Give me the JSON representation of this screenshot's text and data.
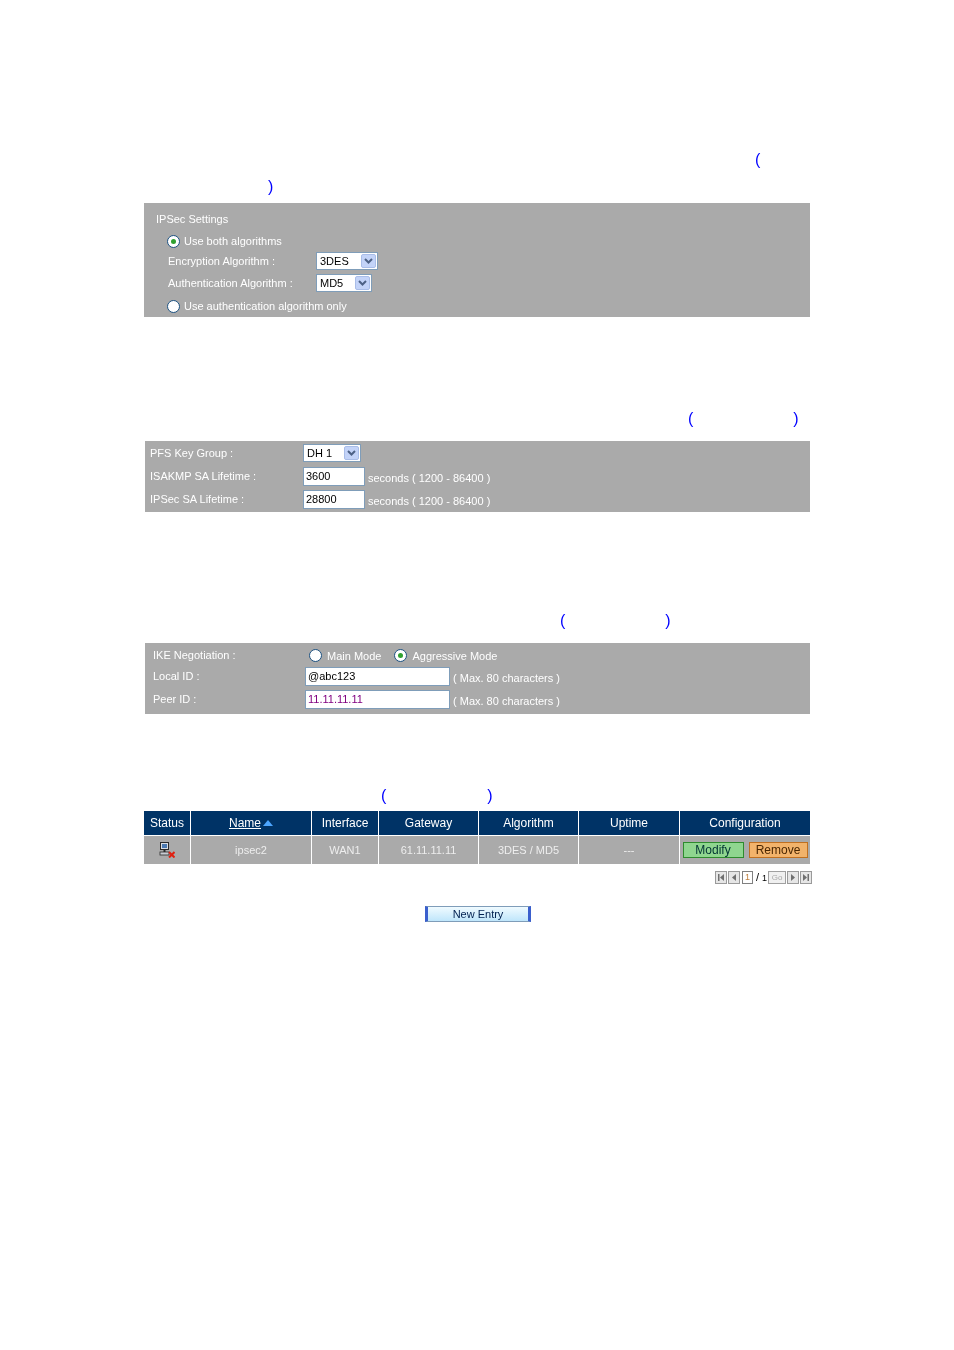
{
  "ipsec_settings": {
    "brackets": [
      "(",
      ")"
    ],
    "title": "IPSec Settings",
    "options": [
      {
        "label": "Use both algorithms",
        "selected": true,
        "fields": [
          {
            "label": "Encryption Algorithm :",
            "value": "3DES"
          },
          {
            "label": "Authentication Algorithm :",
            "value": "MD5"
          }
        ]
      },
      {
        "label": "Use authentication algorithm only",
        "selected": false
      }
    ]
  },
  "lifetime_settings": {
    "brackets": [
      "(",
      ")"
    ],
    "rows": [
      {
        "kind": "select",
        "label": "PFS Key Group :",
        "value": "DH 1"
      },
      {
        "kind": "input",
        "label": "ISAKMP SA Lifetime :",
        "value": "3600",
        "hint": "seconds ( 1200 - 86400 )"
      },
      {
        "kind": "input",
        "label": "IPSec SA Lifetime :",
        "value": "28800",
        "hint": "seconds ( 1200 - 86400 )"
      }
    ]
  },
  "ike_settings": {
    "brackets": [
      "(",
      ")"
    ],
    "rows": [
      {
        "kind": "radio",
        "label": "IKE Negotiation :",
        "options": [
          {
            "label": "Main Mode",
            "selected": false
          },
          {
            "label": "Aggressive Mode",
            "selected": true
          }
        ]
      },
      {
        "kind": "input",
        "label": "Local ID :",
        "value": "@abc123",
        "color": "#000000",
        "hint": "( Max. 80 characters )"
      },
      {
        "kind": "input",
        "label": "Peer ID :",
        "value": "11.11.11.11",
        "color": "#800080",
        "hint": "( Max. 80 characters )"
      }
    ]
  },
  "tunnel_list": {
    "brackets": [
      "(",
      ")"
    ],
    "columns": [
      {
        "label": "Status",
        "sorted": false
      },
      {
        "label": "Name",
        "sorted": true
      },
      {
        "label": "Interface",
        "sorted": false
      },
      {
        "label": "Gateway",
        "sorted": false
      },
      {
        "label": "Algorithm",
        "sorted": false
      },
      {
        "label": "Uptime",
        "sorted": false
      },
      {
        "label": "Configuration",
        "sorted": false
      }
    ],
    "rows": [
      {
        "cells": [
          {
            "kind": "status",
            "connected": false
          },
          {
            "kind": "text",
            "text": "ipsec2"
          },
          {
            "kind": "text",
            "text": "WAN1"
          },
          {
            "kind": "text",
            "text": "61.11.11.11"
          },
          {
            "kind": "text",
            "text": "3DES / MD5"
          },
          {
            "kind": "text",
            "text": "---"
          },
          {
            "kind": "actions",
            "actions": [
              {
                "kind": "modify",
                "label": "Modify"
              },
              {
                "kind": "remove",
                "label": "Remove"
              }
            ]
          }
        ]
      }
    ],
    "pagination": {
      "page": "1",
      "separator": "/",
      "total": "1",
      "go": "Go"
    }
  },
  "new_entry_button": "New Entry"
}
